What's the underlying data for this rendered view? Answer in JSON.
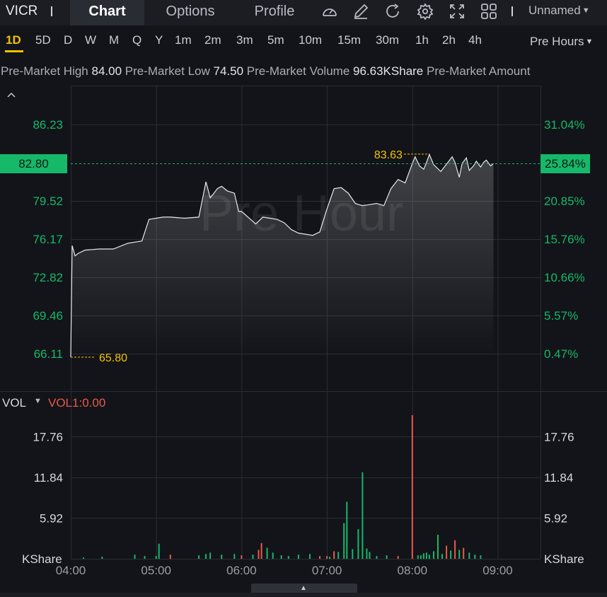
{
  "header": {
    "ticker": "VICR",
    "tabs": [
      {
        "label": "Chart",
        "active": true
      },
      {
        "label": "Options",
        "active": false
      },
      {
        "label": "Profile",
        "active": false
      }
    ],
    "tools": [
      "gauge-icon",
      "draw-icon",
      "refresh-icon",
      "settings-icon",
      "fullscreen-icon",
      "grid-layout-icon"
    ],
    "layout_name": "Unnamed"
  },
  "periods": [
    "1D",
    "5D",
    "D",
    "W",
    "M",
    "Q",
    "Y",
    "1m",
    "2m",
    "3m",
    "5m",
    "10m",
    "15m",
    "30m",
    "1h",
    "2h",
    "4h"
  ],
  "active_period": "1D",
  "session": "Pre Hours",
  "stats": {
    "high_label": "Pre-Market High",
    "high": "84.00",
    "low_label": "Pre-Market Low",
    "low": "74.50",
    "volume_label": "Pre-Market Volume",
    "volume": "96.63KShare",
    "amount_label": "Pre-Market Amount"
  },
  "colors": {
    "up": "#16b86a",
    "down": "#e8584b",
    "accent": "#f2c200",
    "price_line": "#e6e8ec",
    "background": "#131419"
  },
  "chart_data": [
    {
      "type": "area",
      "watermark": "Pre Hour",
      "x_ticks": [
        "04:00",
        "05:00",
        "06:00",
        "07:00",
        "08:00",
        "09:00"
      ],
      "y_ticks_price": [
        "86.23",
        "79.52",
        "76.17",
        "72.82",
        "69.46",
        "66.11"
      ],
      "y_ticks_pct": [
        "31.04%",
        "20.85%",
        "15.76%",
        "10.66%",
        "5.57%",
        "0.47%"
      ],
      "ylim": [
        66.11,
        86.23
      ],
      "current_price": "82.80",
      "current_pct": "25.84%",
      "high_marker": "83.63",
      "low_marker": "65.80",
      "x": [
        "04:00",
        "04:01",
        "04:03",
        "04:05",
        "04:10",
        "04:20",
        "04:30",
        "04:40",
        "04:45",
        "04:50",
        "04:55",
        "05:00",
        "05:05",
        "05:10",
        "05:20",
        "05:30",
        "05:35",
        "05:38",
        "05:40",
        "05:43",
        "05:46",
        "05:50",
        "05:55",
        "05:58",
        "06:00",
        "06:10",
        "06:15",
        "06:20",
        "06:25",
        "06:30",
        "06:35",
        "06:40",
        "06:45",
        "06:50",
        "06:55",
        "07:00",
        "07:05",
        "07:10",
        "07:15",
        "07:20",
        "07:25",
        "07:30",
        "07:35",
        "07:40",
        "07:45",
        "07:50",
        "07:55",
        "08:00",
        "08:02",
        "08:05",
        "08:08",
        "08:10",
        "08:12",
        "08:15",
        "08:20",
        "08:25",
        "08:28",
        "08:30",
        "08:33",
        "08:35",
        "08:38",
        "08:40",
        "08:43",
        "08:45",
        "08:48",
        "08:50",
        "08:52",
        "08:55",
        "08:57"
      ],
      "y": [
        65.8,
        75.6,
        74.7,
        74.9,
        75.2,
        75.3,
        75.3,
        75.8,
        75.9,
        76.0,
        77.9,
        78.0,
        78.1,
        78.1,
        78.0,
        78.1,
        81.2,
        79.8,
        80.1,
        80.6,
        80.8,
        80.4,
        80.2,
        78.6,
        78.6,
        77.5,
        78.1,
        78.0,
        77.9,
        77.6,
        77.0,
        76.7,
        76.6,
        76.5,
        76.8,
        78.8,
        80.6,
        80.7,
        80.2,
        79.3,
        79.1,
        79.2,
        79.3,
        79.1,
        80.6,
        81.4,
        81.1,
        82.8,
        83.4,
        82.6,
        82.3,
        82.9,
        83.6,
        82.7,
        82.1,
        82.9,
        83.4,
        82.9,
        81.6,
        82.8,
        83.3,
        82.2,
        82.6,
        83.0,
        82.5,
        82.9,
        83.1,
        82.6,
        82.8
      ]
    },
    {
      "type": "bar",
      "title": "VOL",
      "indicator_label": "VOL1:0.00",
      "unit": "KShare",
      "y_ticks": [
        "17.76",
        "11.84",
        "5.92"
      ],
      "ylim": [
        0,
        20.9
      ],
      "x": [
        "04:09",
        "04:22",
        "04:45",
        "04:52",
        "05:00",
        "05:02",
        "05:10",
        "05:30",
        "05:35",
        "05:38",
        "05:46",
        "05:55",
        "06:00",
        "06:08",
        "06:12",
        "06:14",
        "06:18",
        "06:22",
        "06:28",
        "06:33",
        "06:40",
        "06:48",
        "06:55",
        "07:00",
        "07:02",
        "07:05",
        "07:08",
        "07:12",
        "07:14",
        "07:18",
        "07:22",
        "07:25",
        "07:28",
        "07:30",
        "07:35",
        "07:42",
        "07:50",
        "08:00",
        "08:04",
        "08:06",
        "08:08",
        "08:10",
        "08:12",
        "08:15",
        "08:18",
        "08:21",
        "08:24",
        "08:27",
        "08:30",
        "08:33",
        "08:36",
        "08:40",
        "08:44",
        "08:48"
      ],
      "values": [
        0.2,
        0.3,
        0.6,
        0.4,
        0.4,
        2.2,
        0.6,
        0.5,
        0.7,
        0.9,
        0.6,
        0.7,
        0.5,
        0.6,
        1.3,
        2.3,
        1.6,
        0.9,
        0.5,
        0.4,
        0.6,
        0.7,
        0.4,
        0.4,
        0.3,
        1.1,
        1.0,
        5.2,
        8.3,
        1.4,
        4.3,
        12.6,
        1.5,
        1.0,
        0.4,
        0.5,
        0.4,
        20.9,
        0.5,
        0.5,
        0.8,
        0.9,
        0.6,
        1.1,
        3.5,
        0.7,
        1.9,
        1.2,
        2.7,
        1.3,
        1.6,
        0.9,
        0.6,
        0.5
      ],
      "direction": [
        "u",
        "u",
        "u",
        "u",
        "u",
        "u",
        "d",
        "u",
        "u",
        "u",
        "u",
        "u",
        "d",
        "u",
        "d",
        "d",
        "u",
        "u",
        "u",
        "u",
        "u",
        "u",
        "d",
        "d",
        "u",
        "d",
        "u",
        "u",
        "u",
        "u",
        "u",
        "u",
        "u",
        "u",
        "u",
        "u",
        "d",
        "d",
        "u",
        "u",
        "u",
        "u",
        "u",
        "u",
        "u",
        "u",
        "d",
        "u",
        "d",
        "u",
        "d",
        "u",
        "u",
        "u"
      ]
    }
  ]
}
